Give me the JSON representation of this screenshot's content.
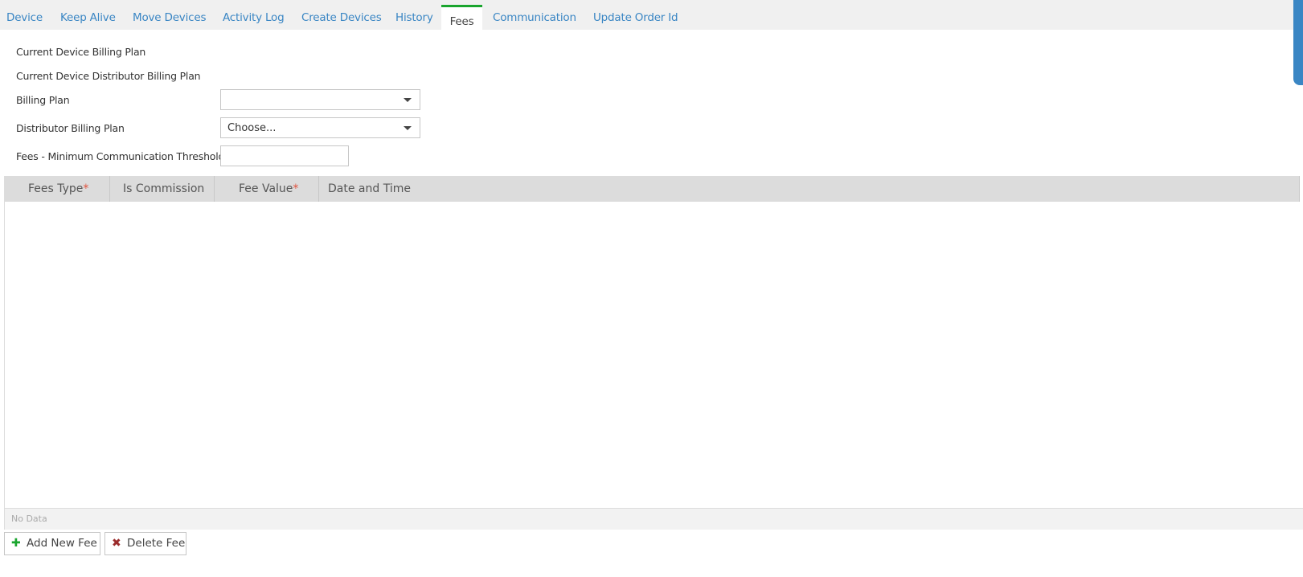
{
  "tabs": [
    {
      "label": "Device"
    },
    {
      "label": "Keep Alive"
    },
    {
      "label": "Move Devices"
    },
    {
      "label": "Activity Log"
    },
    {
      "label": "Create Devices"
    },
    {
      "label": "History"
    },
    {
      "label": "Fees",
      "active": true
    },
    {
      "label": "Communication"
    },
    {
      "label": "Update Order Id"
    }
  ],
  "form": {
    "current_billing_plan_label": "Current Device Billing Plan",
    "current_distributor_billing_plan_label": "Current Device Distributor Billing Plan",
    "billing_plan_label": "Billing Plan",
    "billing_plan_value": "",
    "distributor_billing_plan_label": "Distributor Billing Plan",
    "distributor_billing_plan_value": "Choose...",
    "min_comm_threshold_label": "Fees - Minimum Communication Threshold",
    "min_comm_threshold_value": ""
  },
  "grid": {
    "columns": [
      {
        "label": "Fees Type",
        "required": true
      },
      {
        "label": "Is Commission",
        "required": false
      },
      {
        "label": "Fee Value",
        "required": true
      },
      {
        "label": "Date and Time",
        "required": false
      }
    ],
    "required_marker": "*",
    "rows": [],
    "empty_text": "No Data"
  },
  "buttons": {
    "add_label": "Add New Fee",
    "add_icon": "plus-icon",
    "delete_label": "Delete Fee",
    "delete_icon": "close-icon"
  },
  "colors": {
    "link": "#3a86c4",
    "active_tab_border": "#1aa52e",
    "required": "#e0533f"
  }
}
